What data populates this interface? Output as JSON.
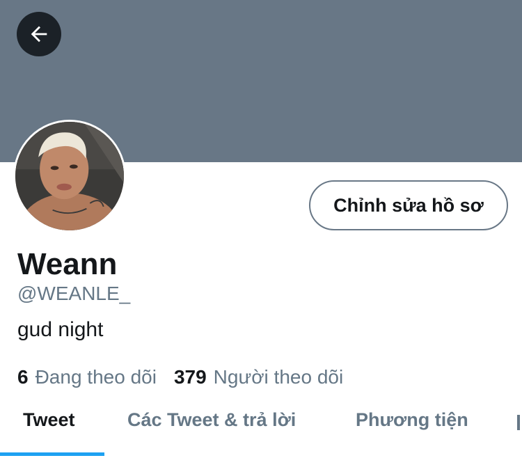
{
  "header": {
    "back_icon": "arrow-left-icon",
    "banner_color": "#687786"
  },
  "profile": {
    "display_name": "Weann",
    "handle": "@WEANLE_",
    "bio": "gud night",
    "edit_button_label": "Chỉnh sửa hồ sơ"
  },
  "stats": {
    "following": {
      "count": "6",
      "label": "Đang theo dõi"
    },
    "followers": {
      "count": "379",
      "label": "Người theo dõi"
    }
  },
  "tabs": [
    {
      "label": "Tweet",
      "active": true
    },
    {
      "label": "Các Tweet & trả lời",
      "active": false
    },
    {
      "label": "Phương tiện",
      "active": false
    }
  ],
  "colors": {
    "accent": "#1da1f2",
    "secondary_text": "#657786",
    "primary_text": "#14171a"
  }
}
